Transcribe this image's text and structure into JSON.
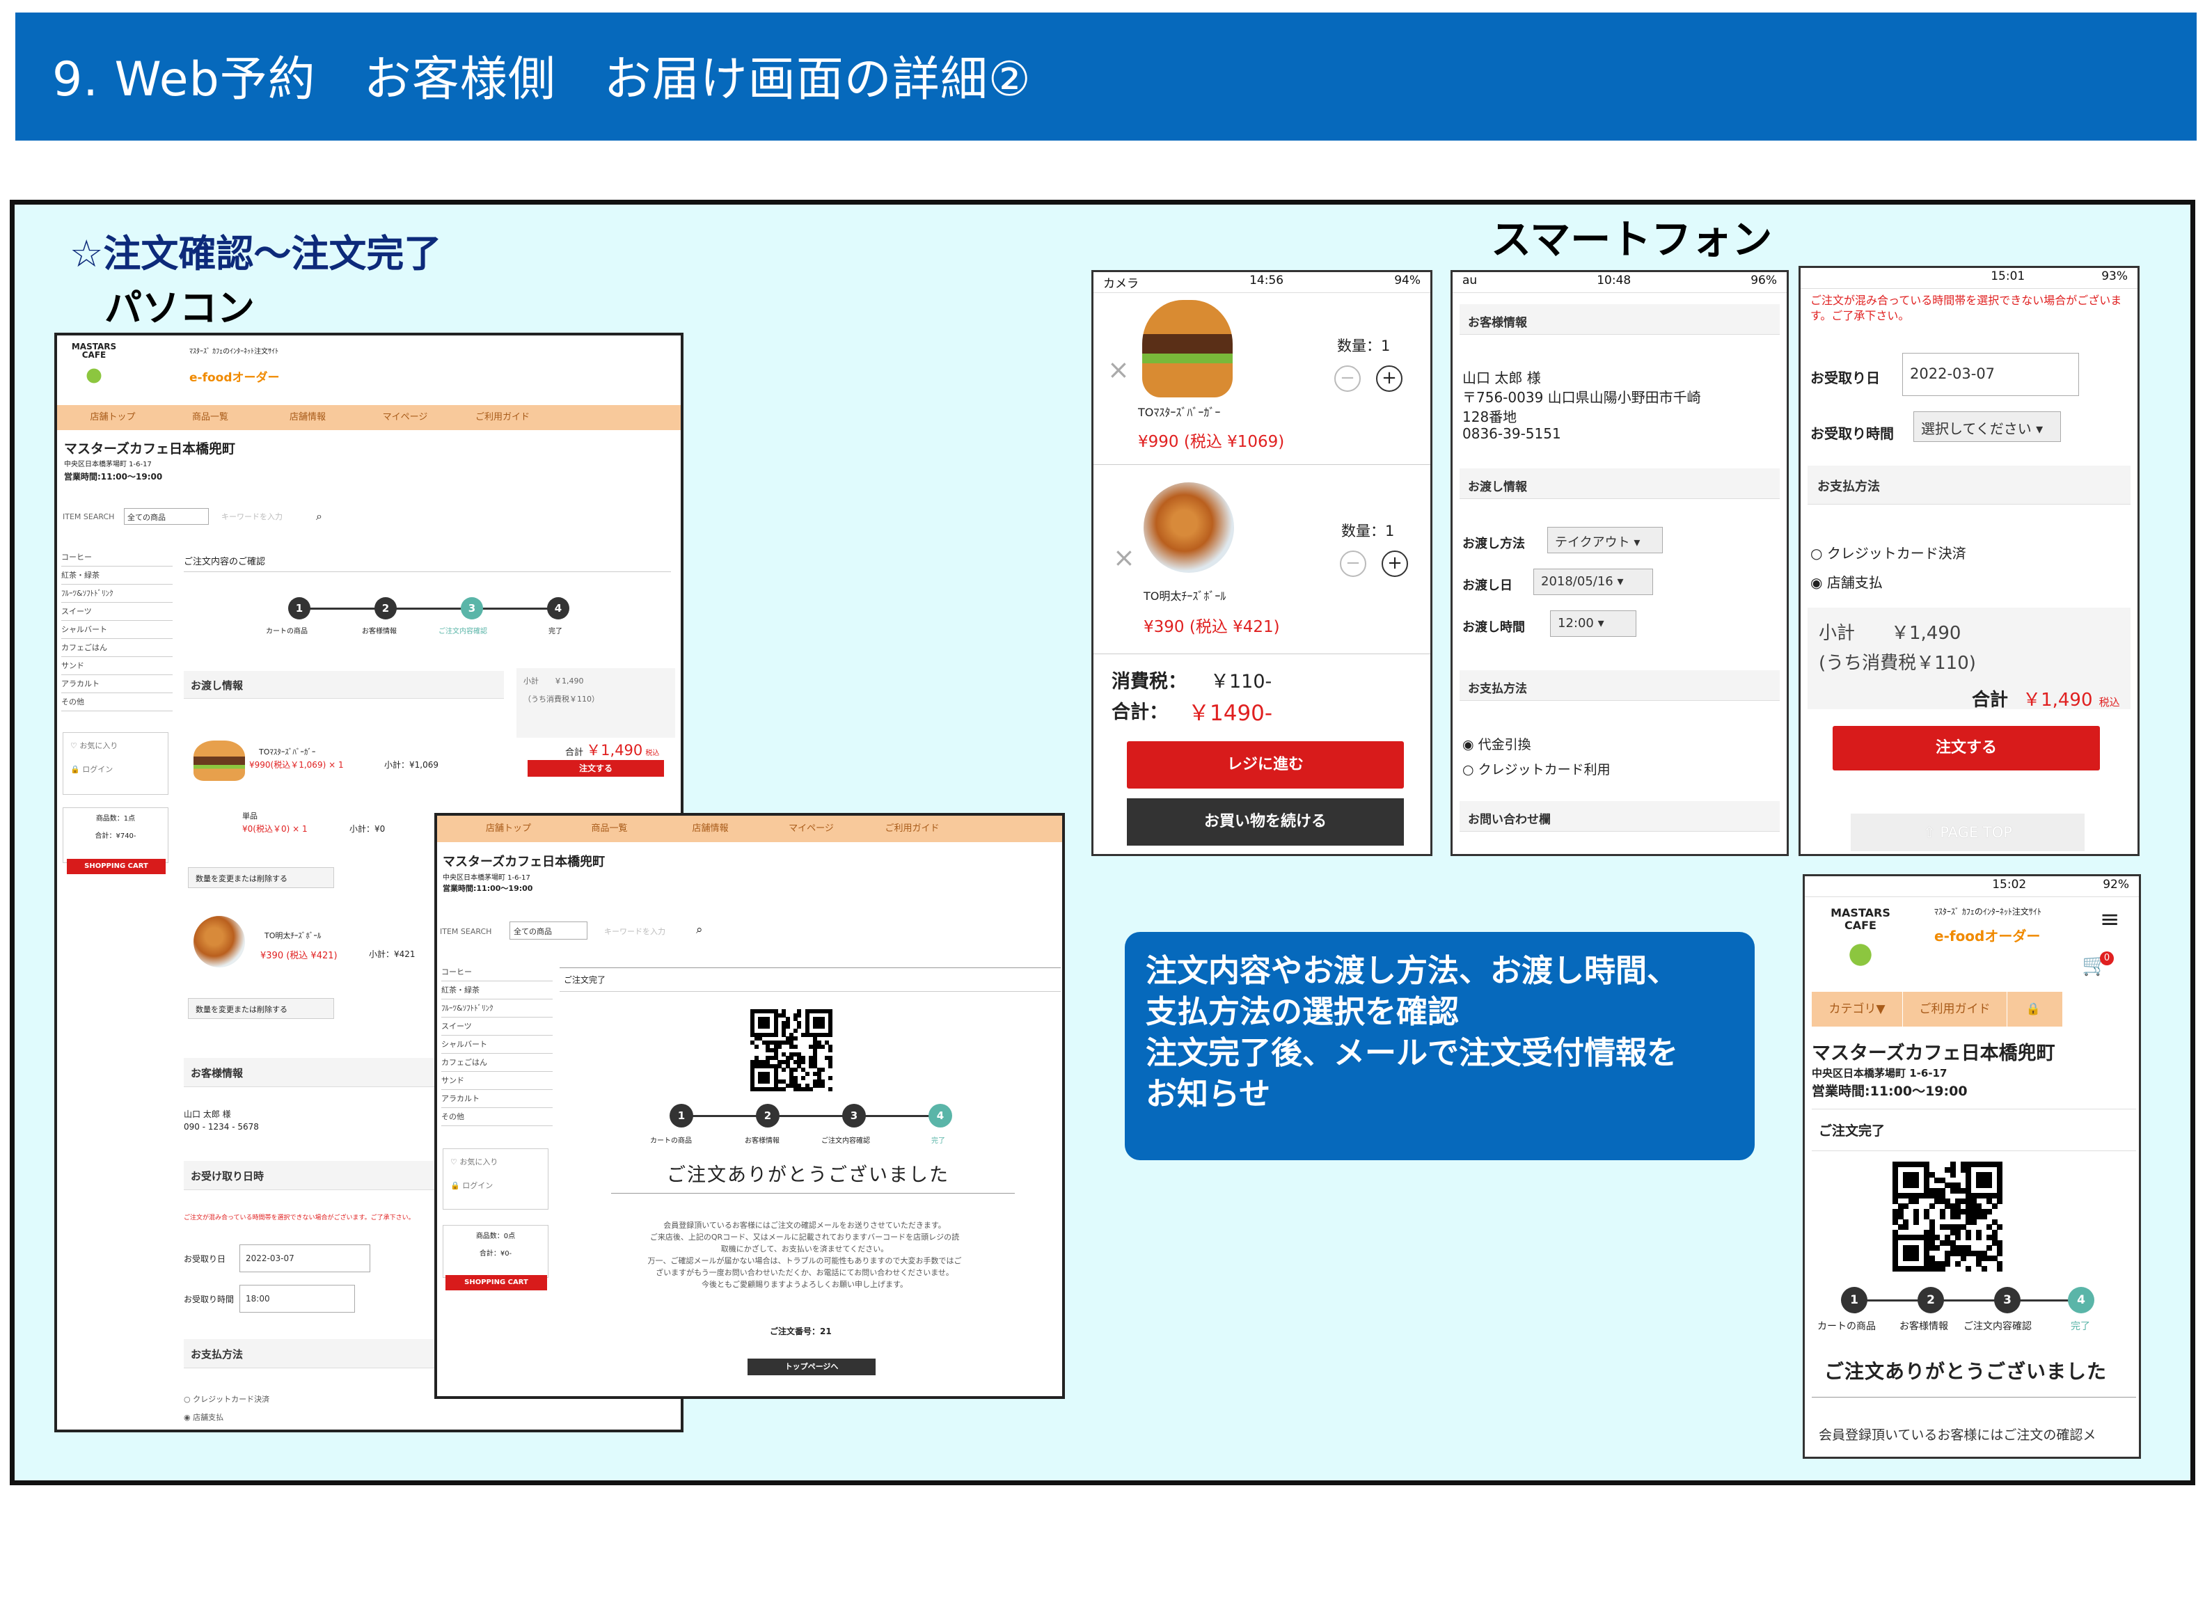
{
  "header": {
    "title": "9. Web予約　お客様側　お届け画面の詳細②"
  },
  "labels": {
    "main": "☆注文確認～注文完了",
    "pc": "パソコン",
    "sp": "スマートフォン"
  },
  "info_box": {
    "text": "注文内容やお渡し方法、お渡し時間、\n支払方法の選択を確認\n注文完了後、メールで注文受付情報を\nお知らせ"
  },
  "pc1": {
    "logo": "MASTARS CAFE",
    "site_caption": "ﾏｽﾀｰｽﾞ ｶﾌｪのｲﾝﾀｰﾈｯﾄ注文ｻｲﾄ",
    "brand": "e-foodオーダー",
    "nav": [
      "店舗トップ",
      "商品一覧",
      "店舗情報",
      "マイページ",
      "ご利用ガイド"
    ],
    "store_name": "マスターズカフェ日本橋兜町",
    "address": "中央区日本橋茅場町 1-6-17",
    "hours": "営業時間:11:00～19:00",
    "search_label": "ITEM SEARCH",
    "search_select": "全ての商品",
    "search_placeholder": "キーワードを入力",
    "categories": [
      "コーヒー",
      "紅茶・緑茶",
      "ﾌﾙｰﾂ&ｿﾌﾄﾄﾞﾘﾝｸ",
      "スイーツ",
      "シャルバート",
      "カフェごはん",
      "サンド",
      "アラカルト",
      "その他"
    ],
    "fav": "お気に入り",
    "login": "ログイン",
    "cart_count": "商品数：1点",
    "cart_total": "合計：¥740-",
    "cart_btn": "SHOPPING CART",
    "confirm_title": "ご注文内容のご確認",
    "steps": [
      "カートの商品",
      "お客様情報",
      "ご注文内容確認",
      "完了"
    ],
    "delivery_title": "お渡し情報",
    "subtotal": "小計　　￥1,490",
    "tax": "（うち消費税￥110）",
    "total_label": "合計",
    "total": "￥1,490",
    "tax_in": "税込",
    "order_btn": "注文する",
    "item1_name": "TOﾏｽﾀｰｽﾞﾊﾞｰｶﾞｰ",
    "item1_price": "¥990(税込￥1,069) × 1",
    "item1_sub": "小計：¥1,069",
    "item0_name": "単品",
    "item0_price": "¥0(税込￥0) × 1",
    "item0_sub": "小計：¥0",
    "change_btn": "数量を変更または削除する",
    "item2_name": "TO明太ﾁｰｽﾞﾎﾞｰﾙ",
    "item2_price": "¥390 (税込 ¥421)",
    "item2_sub": "小計：¥421",
    "customer_title": "お客様情報",
    "customer_name": "山口 太郎 様",
    "customer_tel": "090 - 1234 - 5678",
    "pickup_title": "お受け取り日時",
    "pickup_warn": "ご注文が混み合っている時間帯を選択できない場合がございます。ご了承下さい。",
    "pickup_date_label": "お受取り日",
    "pickup_date": "2022-03-07",
    "pickup_time_label": "お受取り時間",
    "pickup_time": "18:00",
    "pay_title": "お支払方法",
    "pay_options": [
      "クレジットカード決済",
      "店舗支払"
    ]
  },
  "pc2": {
    "nav": [
      "店舗トップ",
      "商品一覧",
      "店舗情報",
      "マイページ",
      "ご利用ガイド"
    ],
    "store_name": "マスターズカフェ日本橋兜町",
    "address": "中央区日本橋茅場町 1-6-17",
    "hours": "営業時間:11:00～19:00",
    "search_label": "ITEM SEARCH",
    "search_select": "全ての商品",
    "search_placeholder": "キーワードを入力",
    "categories": [
      "コーヒー",
      "紅茶・緑茶",
      "ﾌﾙｰﾂ&ｿﾌﾄﾄﾞﾘﾝｸ",
      "スイーツ",
      "シャルバート",
      "カフェごはん",
      "サンド",
      "アラカルト",
      "その他"
    ],
    "fav": "お気に入り",
    "login": "ログイン",
    "cart_count": "商品数：0点",
    "cart_total": "合計：¥0-",
    "cart_btn": "SHOPPING CART",
    "done_title": "ご注文完了",
    "steps": [
      "カートの商品",
      "お客様情報",
      "ご注文内容確認",
      "完了"
    ],
    "thanks": "ご注文ありがとうございました",
    "message": "会員登録頂いているお客様にはご注文の確認メールをお送りさせていただきます。\nご来店後、上記のQRコード、又はメールに記載されておりますバーコードを店頭レジの読\n取機にかざして、お支払いを済ませてください。\n万一、ご確認メールが届かない場合は、トラブルの可能性もありますので大変お手数ではご\nざいますがもう一度お問い合わせいただくか、お電話にてお問い合わせくださいませ。\n今後ともご愛顧賜りますようよろしくお願い申し上げます。",
    "order_no": "ご注文番号：21",
    "top_btn": "トップページへ"
  },
  "sp1": {
    "status": {
      "left": "カメラ",
      "time": "14:56",
      "battery": "94%"
    },
    "item1_name": "TOﾏｽﾀｰｽﾞﾊﾞｰｶﾞｰ",
    "item1_price": "¥990 (税込 ¥1069)",
    "qty_label1": "数量：1",
    "item2_name": "TO明太ﾁｰｽﾞﾎﾞｰﾙ",
    "item2_price": "¥390 (税込 ¥421)",
    "qty_label2": "数量：1",
    "tax_label": "消費税：",
    "tax_value": "￥110-",
    "total_label": "合計：",
    "total_value": "￥1490-",
    "checkout_btn": "レジに進む",
    "continue_btn": "お買い物を続ける"
  },
  "sp2": {
    "status": {
      "left": "au",
      "time": "10:48",
      "battery": "96%"
    },
    "customer_title": "お客様情報",
    "name": "山口 太郎 様",
    "address1": "〒756-0039 山口県山陽小野田市千崎",
    "address2": "128番地",
    "tel": "0836-39-5151",
    "delivery_title": "お渡し情報",
    "method_label": "お渡し方法",
    "method": "テイクアウト",
    "date_label": "お渡し日",
    "date": "2018/05/16",
    "time_label": "お渡し時間",
    "time": "12:00",
    "pay_title": "お支払方法",
    "pay_options": [
      "代金引換",
      "クレジットカード利用"
    ],
    "contact_title": "お問い合わせ欄"
  },
  "sp3": {
    "status": {
      "time": "15:01",
      "battery": "93%"
    },
    "warn": "ご注文が混み合っている時間帯を選択できない場合がございます。ご了承下さい。",
    "date_label": "お受取り日",
    "date": "2022-03-07",
    "time_label": "お受取り時間",
    "time": "選択してください",
    "pay_title": "お支払方法",
    "pay_options": [
      "クレジットカード決済",
      "店舗支払"
    ],
    "subtotal": "小計　　￥1,490",
    "tax": "(うち消費税￥110)",
    "total_label": "合計",
    "total": "￥1,490",
    "tax_in": "税込",
    "order_btn": "注文する",
    "page_top": "⇧ PAGE TOP"
  },
  "sp4": {
    "status": {
      "time": "15:02",
      "battery": "92%"
    },
    "logo": "MASTARS CAFE",
    "site_caption": "ﾏｽﾀｰｽﾞ ｶﾌｪのｲﾝﾀｰﾈｯﾄ注文ｻｲﾄ",
    "brand": "e-foodオーダー",
    "cart_badge": "0",
    "tabs": [
      "カテゴリ▼",
      "ご利用ガイド"
    ],
    "store_name": "マスターズカフェ日本橋兜町",
    "address": "中央区日本橋茅場町 1-6-17",
    "hours": "営業時間:11:00～19:00",
    "done_title": "ご注文完了",
    "steps": [
      "カートの商品",
      "お客様情報",
      "ご注文内容確認",
      "完了"
    ],
    "thanks": "ご注文ありがとうございました",
    "message": "会員登録頂いているお客様にはご注文の確認メ"
  },
  "colors": {
    "header": "#0669bc",
    "frame_bg": "#e0fbfd",
    "accent_red": "#d81b1b",
    "step_active": "#5ab5a8",
    "nav_bg": "#f8c99b"
  }
}
